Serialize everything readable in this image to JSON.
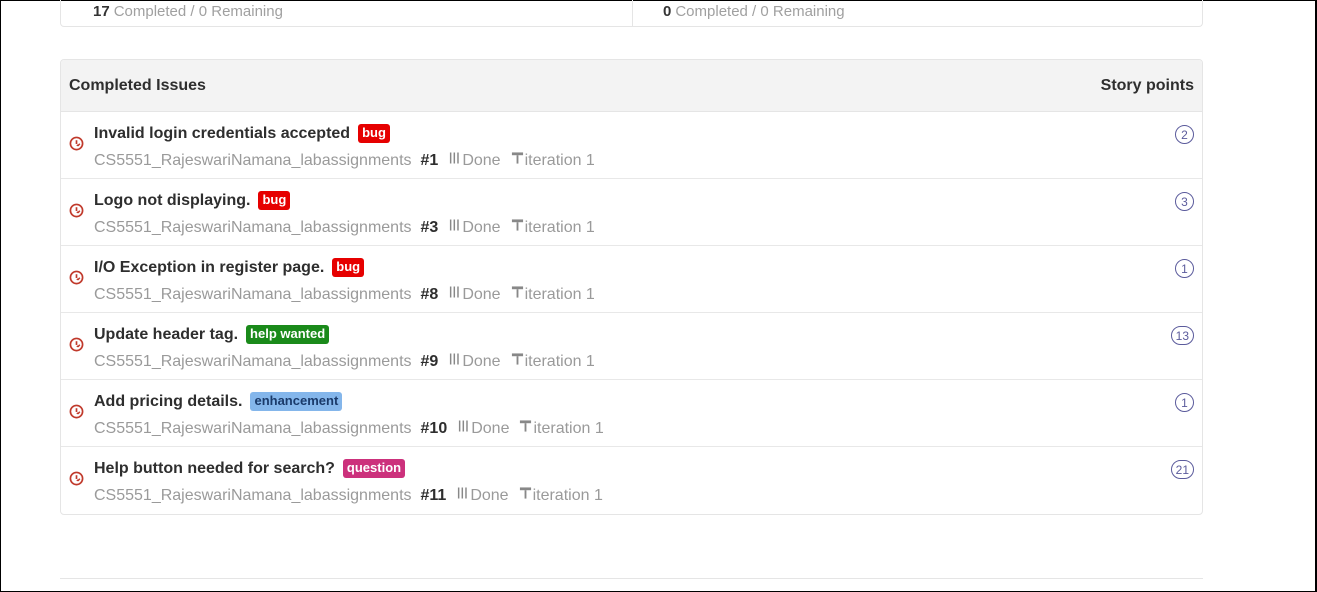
{
  "top_summary": [
    {
      "count": "17",
      "text": "Completed / 0 Remaining"
    },
    {
      "count": "0",
      "text": "Completed / 0 Remaining"
    }
  ],
  "panel": {
    "title": "Completed Issues",
    "points_header": "Story points"
  },
  "issues": [
    {
      "title": "Invalid login credentials accepted",
      "label": "bug",
      "label_color": "#e60000",
      "repo": "CS5551_RajeswariNamana_labassignments",
      "number": "#1",
      "status": "Done",
      "iteration": "iteration 1",
      "points": "2"
    },
    {
      "title": "Logo not displaying.",
      "label": "bug",
      "label_color": "#e60000",
      "repo": "CS5551_RajeswariNamana_labassignments",
      "number": "#3",
      "status": "Done",
      "iteration": "iteration 1",
      "points": "3"
    },
    {
      "title": "I/O Exception in register page.",
      "label": "bug",
      "label_color": "#e60000",
      "repo": "CS5551_RajeswariNamana_labassignments",
      "number": "#8",
      "status": "Done",
      "iteration": "iteration 1",
      "points": "1"
    },
    {
      "title": "Update header tag.",
      "label": "help wanted",
      "label_color": "#1a8a1a",
      "repo": "CS5551_RajeswariNamana_labassignments",
      "number": "#9",
      "status": "Done",
      "iteration": "iteration 1",
      "points": "13"
    },
    {
      "title": "Add pricing details.",
      "label": "enhancement",
      "label_color": "#84b6eb",
      "label_text_color": "#1a3a6a",
      "repo": "CS5551_RajeswariNamana_labassignments",
      "number": "#10",
      "status": "Done",
      "iteration": "iteration 1",
      "points": "1"
    },
    {
      "title": "Help button needed for search?",
      "label": "question",
      "label_color": "#cc317c",
      "repo": "CS5551_RajeswariNamana_labassignments",
      "number": "#11",
      "status": "Done",
      "iteration": "iteration 1",
      "points": "21"
    }
  ],
  "icons": {
    "status": "closed-issue-icon",
    "done": "pipeline-column-icon",
    "iteration": "milestone-icon"
  }
}
